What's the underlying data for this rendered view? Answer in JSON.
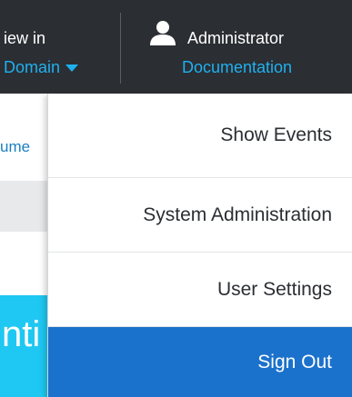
{
  "header": {
    "view_label": "iew in",
    "view_dropdown": "Domain",
    "user_name": "Administrator",
    "docs_link": "Documentation",
    "user_icon": "user-icon",
    "caret_icon": "caret-down-icon"
  },
  "background": {
    "partial_link": "ume",
    "partial_title": "nti"
  },
  "menu": {
    "items": [
      {
        "label": "Show Events"
      },
      {
        "label": "System Administration"
      },
      {
        "label": "User Settings"
      },
      {
        "label": "Sign Out"
      }
    ]
  },
  "colors": {
    "header_bg": "#2b2e33",
    "accent_link": "#1fb0ef",
    "highlight": "#1b72cc",
    "banner_cyan": "#1ec8f2"
  }
}
